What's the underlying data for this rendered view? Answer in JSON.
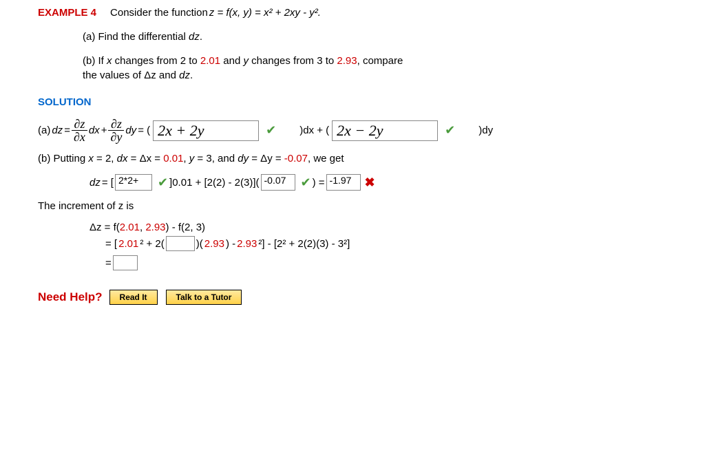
{
  "example": {
    "label": "EXAMPLE 4",
    "prompt_pre": "Consider the function ",
    "prompt_eq": "z = f(x, y) = x² + 2xy - y²."
  },
  "partA": {
    "label": "(a) Find the differential ",
    "dz": "dz",
    "period": "."
  },
  "partB": {
    "pre": "(b) If ",
    "x": "x",
    "mid1": " changes from 2 to ",
    "val1": "2.01",
    "mid2": " and ",
    "y": "y",
    "mid3": " changes from 3 to ",
    "val2": "2.93",
    "post": ", compare",
    "line2": "the values of Δz and ",
    "dz": "dz",
    "period": "."
  },
  "solution_label": "SOLUTION",
  "solA": {
    "lead": "(a) ",
    "dz": "dz",
    "eq": " = ",
    "frac1num": "∂z",
    "frac1den": "∂x",
    "dx": "dx",
    "plus": " + ",
    "frac2num": "∂z",
    "frac2den": "∂y",
    "dy": "dy",
    "eq2": " = ( ",
    "input1": "2x + 2y",
    "mid": " )dx + ( ",
    "input2": "2x − 2y",
    "end": " )dy"
  },
  "solB": {
    "pre": "(b) Putting ",
    "x": "x",
    "eq1": " = 2, ",
    "dx": "dx",
    "eq2": " = Δx = ",
    "v1": "0.01",
    "mid1": ", ",
    "y": "y",
    "eq3": " = 3, and ",
    "dy": "dy",
    "eq4": " = Δy = ",
    "v2": "-0.07",
    "post": ", we get"
  },
  "solB2": {
    "dz": "dz",
    "eq": " = [ ",
    "input1": "2*2+",
    "mid1": " ]0.01 + [2(2) - 2(3)]( ",
    "input2": "-0.07",
    "mid2": " ) = ",
    "input3": "-1.97",
    "cross": "✖"
  },
  "incr_label": "The increment of z is",
  "incr": {
    "l1a": "Δz = f(",
    "l1r1": "2.01",
    "l1b": ", ",
    "l1r2": "2.93",
    "l1c": ") - f(2, 3)",
    "l2a": "= [",
    "l2r1": "2.01",
    "l2b": "² + 2(",
    "l2c": ")(",
    "l2r2": "2.93",
    "l2d": ") - ",
    "l2r3": "2.93",
    "l2e": "²] - [2² + 2(2)(3) - 3²]",
    "l3": "= "
  },
  "help": {
    "label": "Need Help?",
    "read": "Read It",
    "tutor": "Talk to a Tutor"
  }
}
